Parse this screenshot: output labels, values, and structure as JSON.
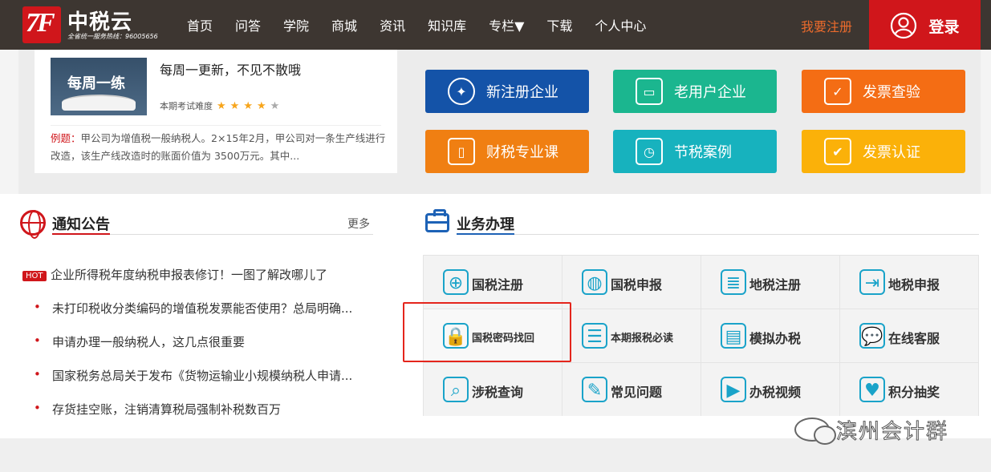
{
  "header": {
    "logo_name": "中税云",
    "logo_hotline": "全省统一服务热线：96005656",
    "nav": [
      "首页",
      "问答",
      "学院",
      "商城",
      "资讯",
      "知识库",
      "专栏▼",
      "下载",
      "个人中心"
    ],
    "register_label": "我要注册",
    "login_label": "登录"
  },
  "weekly": {
    "thumb_title": "每周一练",
    "title": "每周一更新，不见不散哦",
    "difficulty_label": "本期考试难度",
    "difficulty_stars": 4,
    "difficulty_max": 5,
    "example_label": "例题：",
    "example_text": "甲公司为增值税一般纳税人。2×15年2月，甲公司对一条生产线进行改造，该生产线改造时的账面价值为 3500万元。其中..."
  },
  "quick_buttons": [
    {
      "label": "新注册企业",
      "icon": "compass-icon",
      "color": "#1453a8"
    },
    {
      "label": "老用户企业",
      "icon": "briefcase-icon",
      "color": "#1bb68f"
    },
    {
      "label": "发票查验",
      "icon": "clipboard-check-icon",
      "color": "#f46d14"
    },
    {
      "label": "财税专业课",
      "icon": "book-icon",
      "color": "#f07f12"
    },
    {
      "label": "节税案例",
      "icon": "document-clock-icon",
      "color": "#17b2be"
    },
    {
      "label": "发票认证",
      "icon": "checkbox-icon",
      "color": "#fbb109"
    }
  ],
  "notice": {
    "title": "通知公告",
    "more": "更多",
    "hot_badge": "HOT",
    "items": [
      "企业所得税年度纳税申报表修订！一图了解改哪儿了",
      "未打印税收分类编码的增值税发票能否使用？总局明确...",
      "申请办理一般纳税人，这几点很重要",
      "国家税务总局关于发布《货物运输业小规模纳税人申请...",
      "存货挂空账，注销清算税局强制补税数百万"
    ]
  },
  "business": {
    "title": "业务办理",
    "cells": [
      {
        "label": "国税注册",
        "icon": "user-add-icon",
        "glyph": "⊕"
      },
      {
        "label": "国税申报",
        "icon": "globe-icon",
        "glyph": "◍"
      },
      {
        "label": "地税注册",
        "icon": "form-icon",
        "glyph": "≣"
      },
      {
        "label": "地税申报",
        "icon": "document-arrow-icon",
        "glyph": "⇥"
      },
      {
        "label": "国税密码找回",
        "icon": "lock-icon",
        "glyph": "🔒"
      },
      {
        "label": "本期报税必读",
        "icon": "checklist-icon",
        "glyph": "☰"
      },
      {
        "label": "模拟办税",
        "icon": "clapper-icon",
        "glyph": "▤"
      },
      {
        "label": "在线客服",
        "icon": "chat-icon",
        "glyph": "💬"
      },
      {
        "label": "涉税查询",
        "icon": "browser-search-icon",
        "glyph": "⌕"
      },
      {
        "label": "常见问题",
        "icon": "note-pen-icon",
        "glyph": "✎"
      },
      {
        "label": "办税视频",
        "icon": "video-play-icon",
        "glyph": "▶"
      },
      {
        "label": "积分抽奖",
        "icon": "gift-icon",
        "glyph": "♥"
      }
    ]
  },
  "watermark": "滨州会计群"
}
